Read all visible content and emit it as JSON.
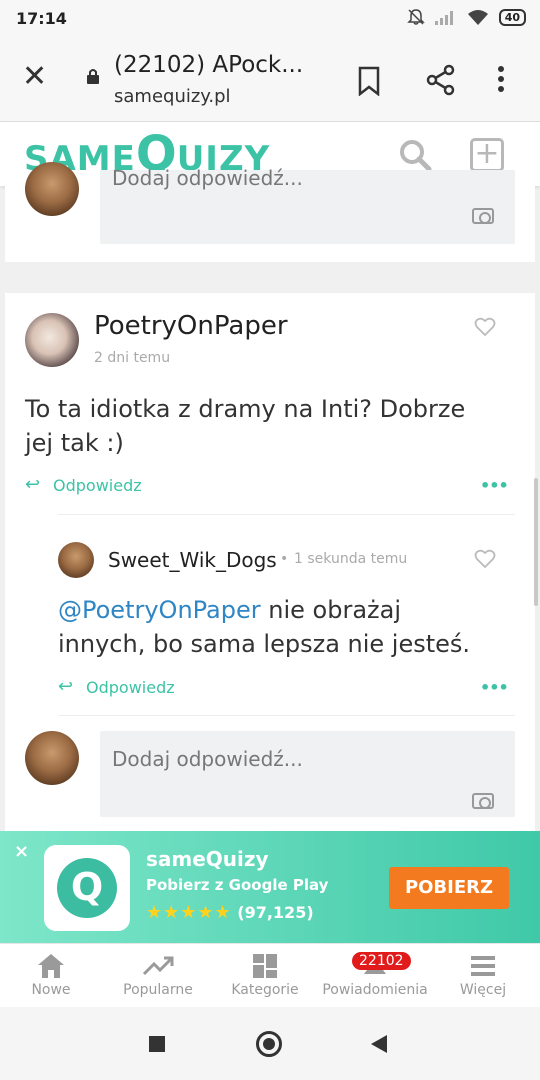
{
  "status_bar": {
    "time": "17:14",
    "battery": "40"
  },
  "browser": {
    "tab_title": "(22102) APock...",
    "url": "samequizy.pl"
  },
  "site": {
    "logo_prefix": "SAME",
    "logo_q": "Q",
    "logo_suffix": "UIZY"
  },
  "top_reply_box": {
    "placeholder": "Dodaj odpowiedź..."
  },
  "comment": {
    "author": "PoetryOnPaper",
    "time": "2 dni temu",
    "text": "To ta idiotka z dramy na Inti? Dobrze jej tak :)",
    "reply_label": "Odpowiedz",
    "more": "•••"
  },
  "reply": {
    "author": "Sweet_Wik_Dogs",
    "separator": "•",
    "time": "1 sekunda temu",
    "mention": "@PoetryOnPaper",
    "text": " nie obrażaj innych, bo sama lepsza nie jesteś.",
    "reply_label": "Odpowiedz",
    "more": "•••"
  },
  "bottom_reply_box": {
    "placeholder": "Dodaj odpowiedź..."
  },
  "ad": {
    "close": "×",
    "icon_letter": "Q",
    "app_name": "sameQuizy",
    "subtitle": "Pobierz z Google Play",
    "stars": "★★★★★",
    "rating_count": "(97,125)",
    "button": "POBIERZ"
  },
  "bottom_nav": {
    "items": [
      {
        "label": "Nowe",
        "icon": "home-icon"
      },
      {
        "label": "Popularne",
        "icon": "trending-icon"
      },
      {
        "label": "Kategorie",
        "icon": "grid-icon"
      },
      {
        "label": "Powiadomienia",
        "icon": "bell-icon"
      },
      {
        "label": "Więcej",
        "icon": "menu-icon"
      }
    ],
    "badge": "22102"
  },
  "colors": {
    "brand": "#3cc3a6",
    "mention": "#2f86c4",
    "ad_button": "#f47a1f",
    "badge": "#e11b1b"
  }
}
